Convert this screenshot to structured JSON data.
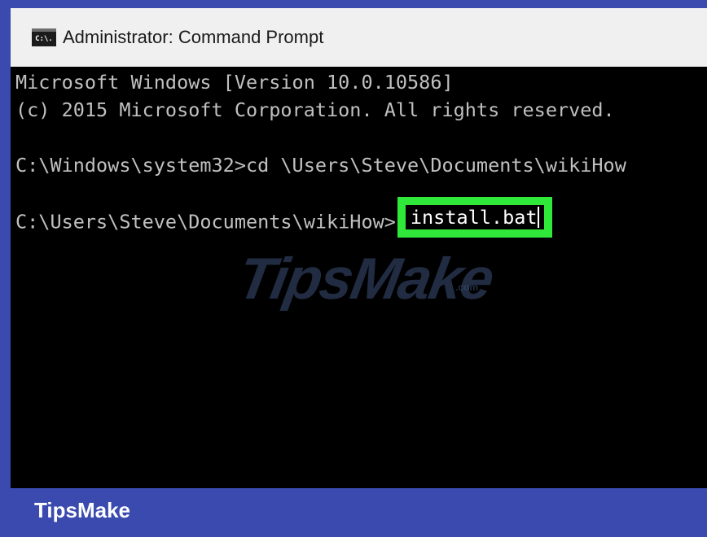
{
  "window": {
    "title": "Administrator: Command Prompt",
    "icon": "cmd-icon",
    "icon_text": "C:\\."
  },
  "console": {
    "lines": [
      "Microsoft Windows [Version 10.0.10586]",
      "(c) 2015 Microsoft Corporation. All rights reserved.",
      "C:\\Windows\\system32>cd \\Users\\Steve\\Documents\\wikiHow",
      "C:\\Users\\Steve\\Documents\\wikiHow>"
    ],
    "current_command": "install.bat"
  },
  "watermark": {
    "main": "TipsMake",
    "sub": ".com"
  },
  "brand": {
    "label": "TipsMake"
  },
  "colors": {
    "frame": "#3a4aae",
    "highlight": "#2fe83a",
    "console_bg": "#000000",
    "console_text": "#c0c0c0"
  }
}
